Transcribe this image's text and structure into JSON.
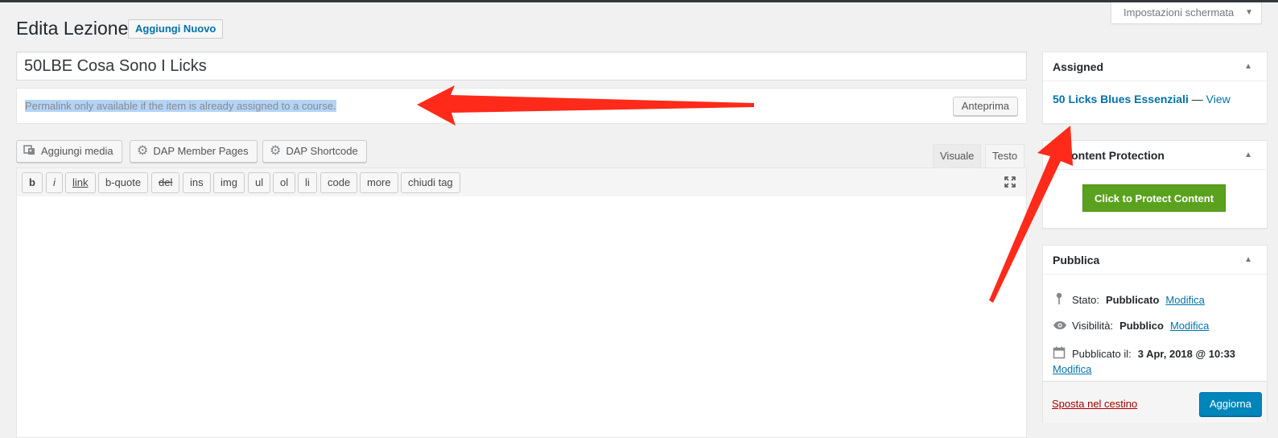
{
  "screen_options": {
    "label": "Impostazioni schermata"
  },
  "heading": {
    "title": "Edita Lezione",
    "add_new_label": "Aggiungi Nuovo"
  },
  "post": {
    "title": "50LBE Cosa Sono I Licks",
    "permalink_notice": "Permalink only available if the item is already assigned to a course.",
    "preview_label": "Anteprima"
  },
  "media_buttons": [
    {
      "label": "Aggiungi media",
      "icon": "media-icon"
    },
    {
      "label": "DAP Member Pages",
      "icon": "gear-icon"
    },
    {
      "label": "DAP Shortcode",
      "icon": "gear-icon"
    }
  ],
  "editor": {
    "tabs": {
      "visual": "Visuale",
      "text": "Testo"
    },
    "quicktags": [
      "b",
      "i",
      "link",
      "b-quote",
      "del",
      "ins",
      "img",
      "ul",
      "ol",
      "li",
      "code",
      "more",
      "chiudi tag"
    ]
  },
  "sidebar": {
    "assigned": {
      "title": "Assigned",
      "course": "50 Licks Blues Essenziali",
      "separator": " — ",
      "view": "View"
    },
    "dap": {
      "title": "P Content Protection",
      "button": "Click to Protect Content"
    },
    "publish": {
      "title": "Pubblica",
      "status_label": "Stato:",
      "status_value": "Pubblicato",
      "visibility_label": "Visibilità:",
      "visibility_value": "Pubblico",
      "date_label": "Pubblicato il:",
      "date_value": "3 Apr, 2018 @ 10:33",
      "edit": "Modifica",
      "trash": "Sposta nel cestino",
      "update": "Aggiorna"
    }
  },
  "colors": {
    "annotation_arrow": "#ff2a1a",
    "link": "#0073aa",
    "primary_button": "#0085ba",
    "protect_button": "#5aa21e"
  }
}
